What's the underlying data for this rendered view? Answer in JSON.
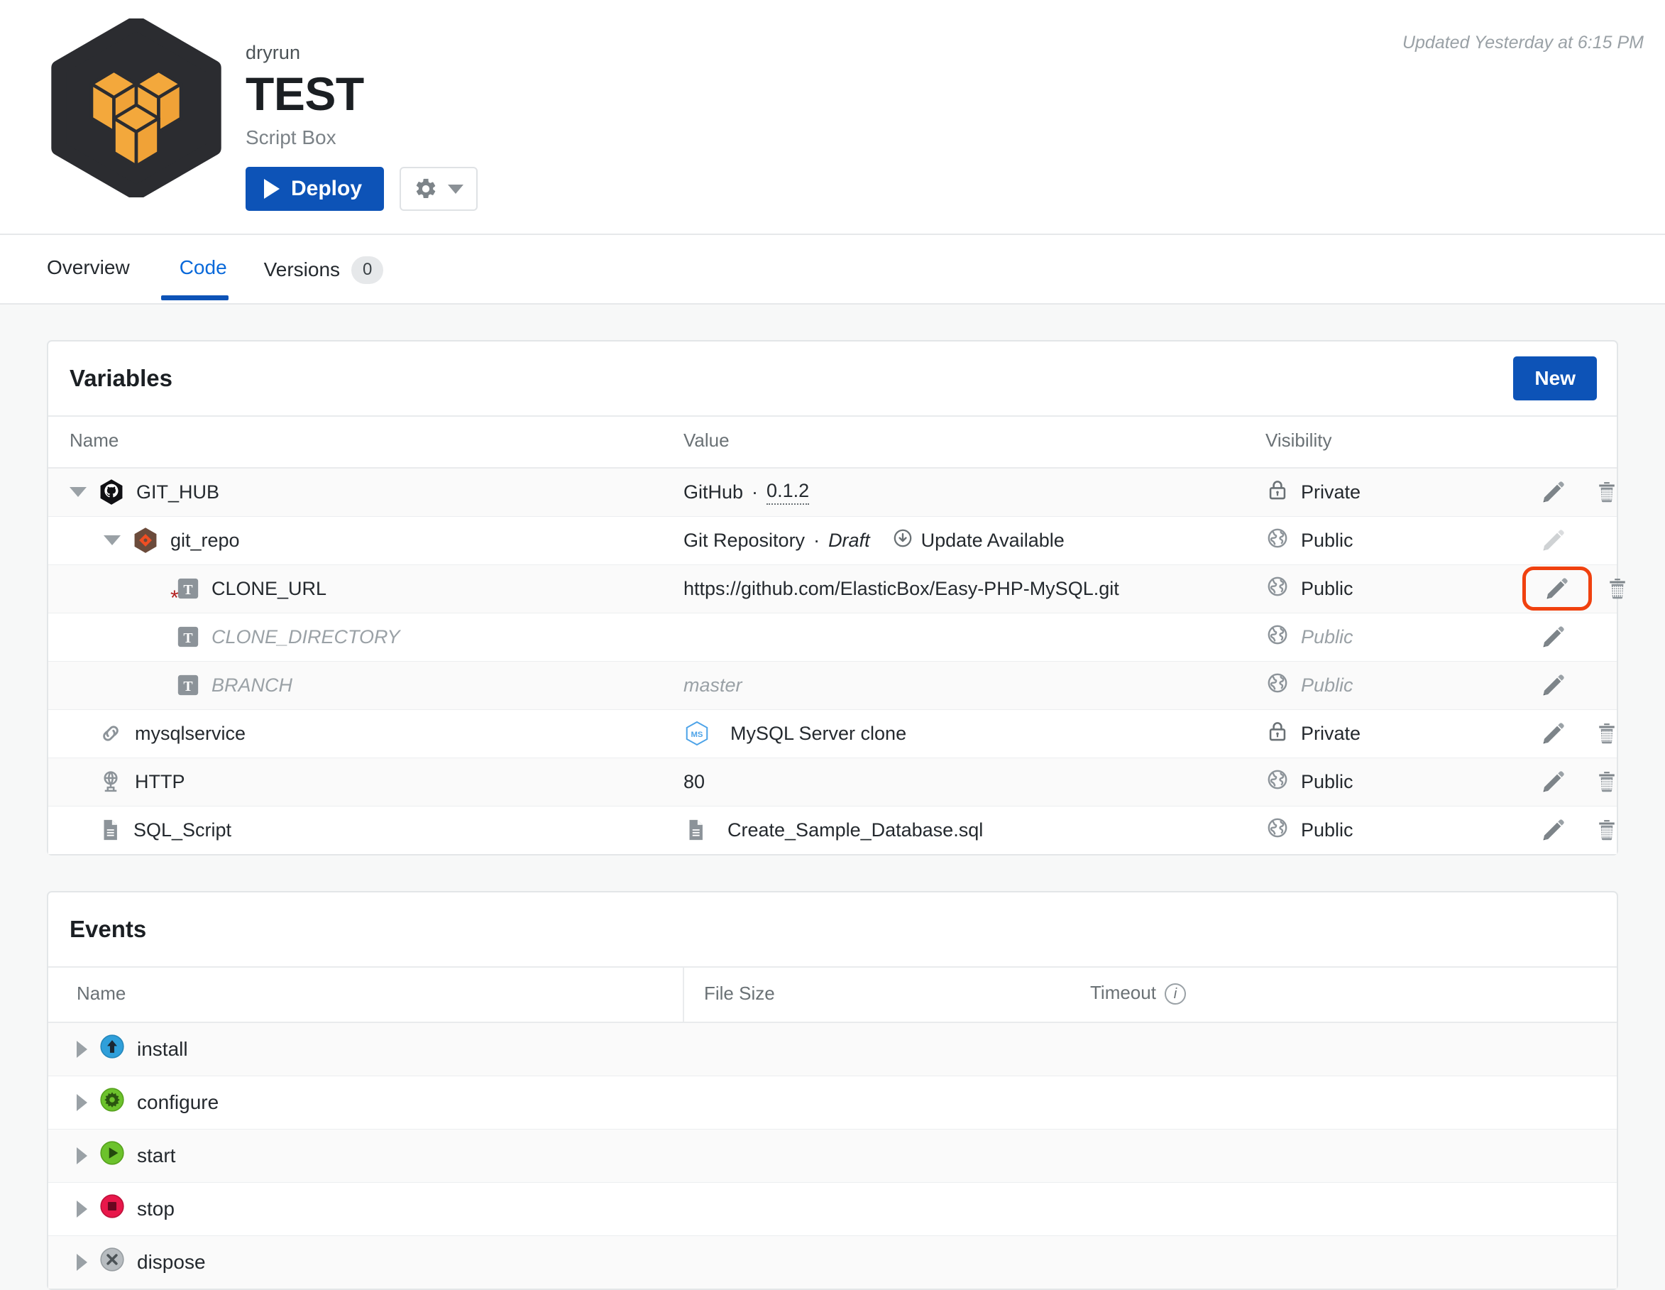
{
  "header": {
    "org_name": "dryrun",
    "box_title": "TEST",
    "box_type": "Script Box",
    "deploy_label": "Deploy",
    "settings_icon": "gear-icon",
    "caret_icon": "chevron-down-icon",
    "updated_text": "Updated Yesterday at 6:15 PM",
    "logo_icon": "cubes-hexagon-logo",
    "logo_bg_color": "#2b2c30",
    "logo_cube_color": "#f3a83c",
    "accent_color": "#0d53b7"
  },
  "tabs": [
    {
      "label": "Overview",
      "active": false,
      "badge": null
    },
    {
      "label": "Code",
      "active": true,
      "badge": null
    },
    {
      "label": "Versions",
      "active": false,
      "badge": "0"
    }
  ],
  "variables_panel": {
    "title": "Variables",
    "new_button_label": "New",
    "columns": [
      "Name",
      "Value",
      "Visibility"
    ],
    "rows": [
      {
        "name": "GIT_HUB",
        "name_icon": "github-octocat-icon",
        "indent": 1,
        "twisty": "down",
        "required": false,
        "muted": false,
        "value_text": "GitHub",
        "value_sep": "·",
        "value_version": "0.1.2",
        "value_version_underline": true,
        "value_draft": null,
        "value_update_available": null,
        "value_badge": null,
        "value_icon": null,
        "visibility": "Private",
        "visibility_icon": "lock-icon",
        "visibility_muted": false,
        "has_edit": true,
        "edit_disabled": false,
        "edit_highlighted": false,
        "has_delete": true,
        "shaded": true
      },
      {
        "name": "git_repo",
        "name_icon": "git-repo-hexagon-icon",
        "indent": 2,
        "twisty": "down",
        "required": false,
        "muted": false,
        "value_text": "Git Repository",
        "value_sep": "·",
        "value_version": null,
        "value_version_underline": false,
        "value_draft": "Draft",
        "value_update_available": "Update Available",
        "value_badge": null,
        "value_icon": null,
        "visibility": "Public",
        "visibility_icon": "globe-icon",
        "visibility_muted": false,
        "has_edit": true,
        "edit_disabled": true,
        "edit_highlighted": false,
        "has_delete": false,
        "shaded": false
      },
      {
        "name": "CLONE_URL",
        "name_icon": "text-variable-icon",
        "indent": 3,
        "twisty": "none",
        "required": true,
        "muted": false,
        "value_text": "https://github.com/ElasticBox/Easy-PHP-MySQL.git",
        "value_sep": null,
        "value_version": null,
        "value_version_underline": false,
        "value_draft": null,
        "value_update_available": null,
        "value_badge": null,
        "value_icon": null,
        "visibility": "Public",
        "visibility_icon": "globe-icon",
        "visibility_muted": false,
        "has_edit": true,
        "edit_disabled": false,
        "edit_highlighted": true,
        "has_delete": true,
        "shaded": true
      },
      {
        "name": "CLONE_DIRECTORY",
        "name_icon": "text-variable-icon",
        "indent": 3,
        "twisty": "none",
        "required": false,
        "muted": true,
        "value_text": "",
        "value_sep": null,
        "value_version": null,
        "value_version_underline": false,
        "value_draft": null,
        "value_update_available": null,
        "value_badge": null,
        "value_icon": null,
        "visibility": "Public",
        "visibility_icon": "globe-icon",
        "visibility_muted": true,
        "has_edit": true,
        "edit_disabled": false,
        "edit_highlighted": false,
        "has_delete": false,
        "shaded": false
      },
      {
        "name": "BRANCH",
        "name_icon": "text-variable-icon",
        "indent": 3,
        "twisty": "none",
        "required": false,
        "muted": true,
        "value_text": "master",
        "value_sep": null,
        "value_version": null,
        "value_version_underline": false,
        "value_draft": null,
        "value_update_available": null,
        "value_badge": null,
        "value_icon": null,
        "value_muted": true,
        "visibility": "Public",
        "visibility_icon": "globe-icon",
        "visibility_muted": true,
        "has_edit": true,
        "edit_disabled": false,
        "edit_highlighted": false,
        "has_delete": false,
        "shaded": true
      },
      {
        "name": "mysqlservice",
        "name_icon": "link-chain-icon",
        "indent": 1,
        "twisty": "none",
        "required": false,
        "muted": false,
        "value_text": "MySQL Server clone",
        "value_sep": null,
        "value_version": null,
        "value_version_underline": false,
        "value_draft": null,
        "value_update_available": null,
        "value_badge": "MS",
        "value_icon": "mysql-hexagon-badge-icon",
        "visibility": "Private",
        "visibility_icon": "lock-icon",
        "visibility_muted": false,
        "has_edit": true,
        "edit_disabled": false,
        "edit_highlighted": false,
        "has_delete": true,
        "shaded": false
      },
      {
        "name": "HTTP",
        "name_icon": "port-globe-icon",
        "indent": 1,
        "twisty": "none",
        "required": false,
        "muted": false,
        "value_text": "80",
        "value_sep": null,
        "value_version": null,
        "value_version_underline": false,
        "value_draft": null,
        "value_update_available": null,
        "value_badge": null,
        "value_icon": null,
        "visibility": "Public",
        "visibility_icon": "globe-icon",
        "visibility_muted": false,
        "has_edit": true,
        "edit_disabled": false,
        "edit_highlighted": false,
        "has_delete": true,
        "shaded": true
      },
      {
        "name": "SQL_Script",
        "name_icon": "file-document-icon",
        "indent": 1,
        "twisty": "none",
        "required": false,
        "muted": false,
        "value_text": "Create_Sample_Database.sql",
        "value_sep": null,
        "value_version": null,
        "value_version_underline": false,
        "value_draft": null,
        "value_update_available": null,
        "value_badge": null,
        "value_icon": "file-document-icon",
        "visibility": "Public",
        "visibility_icon": "globe-icon",
        "visibility_muted": false,
        "has_edit": true,
        "edit_disabled": false,
        "edit_highlighted": false,
        "has_delete": true,
        "shaded": false
      }
    ]
  },
  "events_panel": {
    "title": "Events",
    "columns": [
      "Name",
      "File Size",
      "Timeout"
    ],
    "timeout_info_icon": "info-icon",
    "rows": [
      {
        "name": "install",
        "icon": "install-arrow-up-icon",
        "icon_color": "#2f9fda",
        "file_size": "",
        "timeout": "",
        "shaded": true
      },
      {
        "name": "configure",
        "icon": "configure-gear-icon",
        "icon_color": "#6cc22c",
        "file_size": "",
        "timeout": "",
        "shaded": false
      },
      {
        "name": "start",
        "icon": "start-play-icon",
        "icon_color": "#6cc22c",
        "file_size": "",
        "timeout": "",
        "shaded": true
      },
      {
        "name": "stop",
        "icon": "stop-square-icon",
        "icon_color": "#e8174a",
        "file_size": "",
        "timeout": "",
        "shaded": false
      },
      {
        "name": "dispose",
        "icon": "dispose-x-icon",
        "icon_color": "#b7bcc0",
        "file_size": "",
        "timeout": "",
        "shaded": true
      }
    ]
  }
}
